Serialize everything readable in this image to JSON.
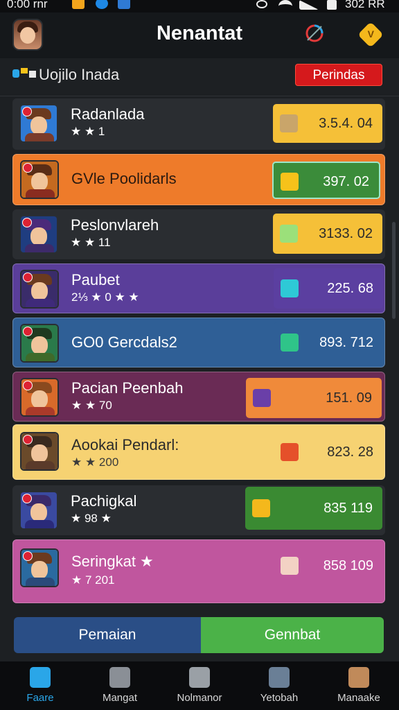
{
  "status_bar": {
    "time": "0:00 rnr",
    "battery": "302 RR"
  },
  "header": {
    "title": "Nenantat",
    "badge_letter": "V"
  },
  "subheader": {
    "title": "Uojilo Inada",
    "action_label": "Perindas"
  },
  "rows": [
    {
      "name": "Radanlada",
      "meta": "★ ★ 1",
      "score": "3.5.4. 04",
      "bg": "#2a2d31",
      "box": "#f5c038",
      "gem": "#c9a56a"
    },
    {
      "name": "GVle Poolidarls",
      "meta": "",
      "score": "397. 02",
      "bg": "#ee7b2a",
      "box": "#3b8c3a",
      "gem": "#f6c21a"
    },
    {
      "name": "Peslonvlareh",
      "meta": "★ ★ 11",
      "score": "3133. 02",
      "bg": "#2a2d31",
      "box": "#f5c038",
      "gem": "#9be07a"
    },
    {
      "name": "Paubet",
      "meta": "2⅓ ★ 0 ★ ★",
      "score": "225. 68",
      "bg": "#5a3e9a",
      "box": "#5b3fa0",
      "gem": "#2ec9d6"
    },
    {
      "name": "GO0 Gercdals2",
      "meta": "",
      "score": "893. 712",
      "bg": "#2f5f96",
      "box": "#2f5f96",
      "gem": "#2fc489"
    },
    {
      "name": "Pacian Peenbah",
      "meta": "★ ★ 70",
      "score": "151. 09",
      "bg": "#6a2b55",
      "box": "#f08a3a",
      "gem": "#6a3fa8"
    },
    {
      "name": "Aookai Pendarl:",
      "meta": "★ ★ 200",
      "score": "823. 28",
      "bg": "#f6d272",
      "box": "#f6d272",
      "gem": "#e5502a"
    },
    {
      "name": "Pachigkal",
      "meta": "★ 98 ★",
      "score": "835 119",
      "bg": "#2a2d31",
      "box": "#3a8a32",
      "gem": "#f4b81c"
    },
    {
      "name": "Seringkat ★",
      "meta": "★ 7 201",
      "score": "858 109",
      "bg": "#c0569e",
      "box": "#c0569e",
      "gem": "#f3d2c4"
    }
  ],
  "buttons": {
    "left": "Pemaian",
    "right": "Gennbat"
  },
  "nav": [
    {
      "label": "Faare",
      "active": true
    },
    {
      "label": "Mangat",
      "active": false
    },
    {
      "label": "Nolmanor",
      "active": false
    },
    {
      "label": "Yetobah",
      "active": false
    },
    {
      "label": "Manaake",
      "active": false
    }
  ],
  "colors": {
    "accent": "#d5191c",
    "nav_active": "#2aa6e8"
  }
}
